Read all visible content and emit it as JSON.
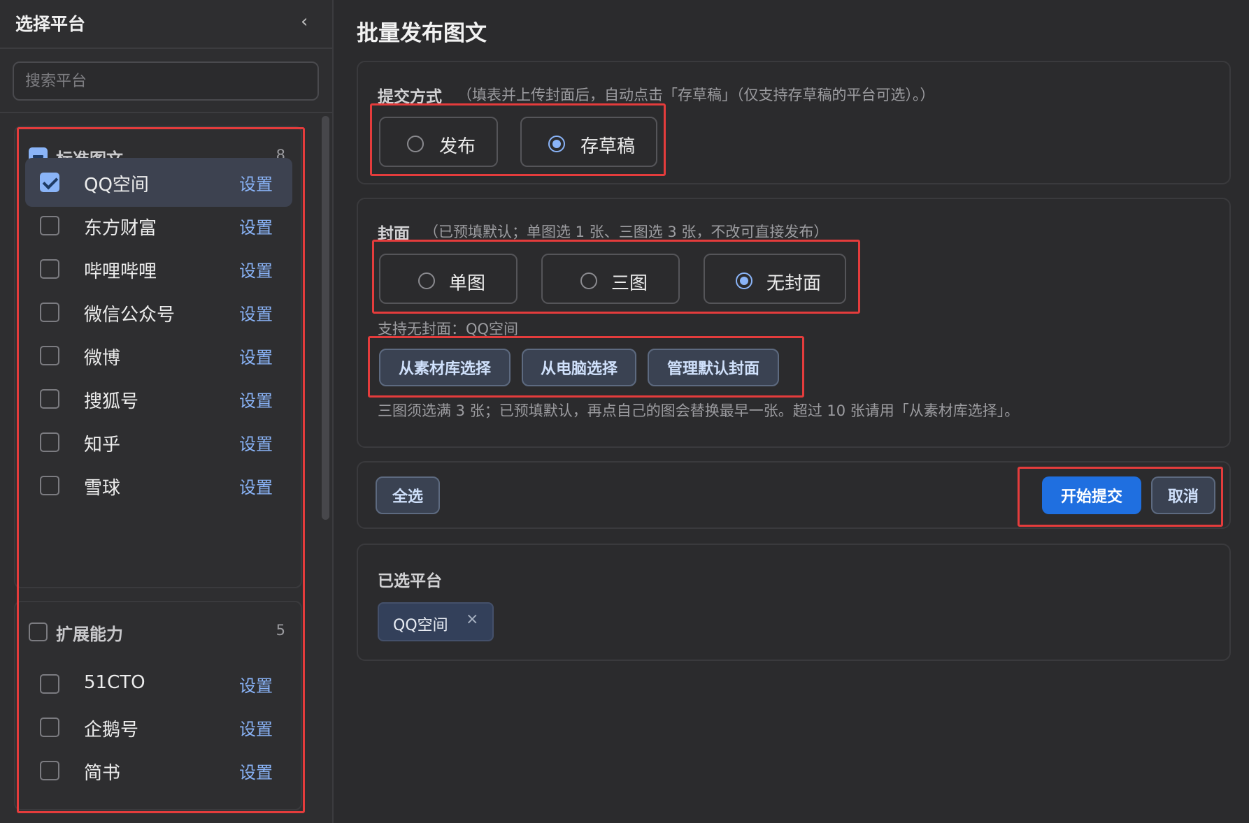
{
  "sidebar": {
    "title": "选择平台",
    "collapse_glyph": "‹",
    "search_placeholder": "搜索平台",
    "groups": [
      {
        "title": "标准图文",
        "count": "8",
        "state": "indeterminate",
        "items": [
          {
            "label": "QQ空间",
            "action": "设置",
            "checked": true
          },
          {
            "label": "东方财富",
            "action": "设置",
            "checked": false
          },
          {
            "label": "哔哩哔哩",
            "action": "设置",
            "checked": false
          },
          {
            "label": "微信公众号",
            "action": "设置",
            "checked": false
          },
          {
            "label": "微博",
            "action": "设置",
            "checked": false
          },
          {
            "label": "搜狐号",
            "action": "设置",
            "checked": false
          },
          {
            "label": "知乎",
            "action": "设置",
            "checked": false
          },
          {
            "label": "雪球",
            "action": "设置",
            "checked": false
          }
        ]
      },
      {
        "title": "扩展能力",
        "count": "5",
        "state": "unchecked",
        "items": [
          {
            "label": "51CTO",
            "action": "设置",
            "checked": false
          },
          {
            "label": "企鹅号",
            "action": "设置",
            "checked": false
          },
          {
            "label": "简书",
            "action": "设置",
            "checked": false
          }
        ]
      }
    ]
  },
  "main": {
    "title": "批量发布图文",
    "submit": {
      "label": "提交方式",
      "hint": "（填表并上传封面后，自动点击「存草稿」（仅支持存草稿的平台可选）。）",
      "options": [
        {
          "label": "发布",
          "selected": false
        },
        {
          "label": "存草稿",
          "selected": true
        }
      ]
    },
    "cover": {
      "label": "封面",
      "hint": "（已预填默认；单图选 1 张、三图选 3 张，不改可直接发布）",
      "options": [
        {
          "label": "单图",
          "selected": false
        },
        {
          "label": "三图",
          "selected": false
        },
        {
          "label": "无封面",
          "selected": true
        }
      ],
      "support_note": "支持无封面：QQ空间",
      "buttons": [
        "从素材库选择",
        "从电脑选择",
        "管理默认封面"
      ],
      "note": "三图须选满 3 张；已预填默认，再点自己的图会替换最早一张。超过 10 张请用「从素材库选择」。"
    },
    "actions": {
      "select_all": "全选",
      "start": "开始提交",
      "cancel": "取消"
    },
    "selected_platforms": {
      "label": "已选平台",
      "chips": [
        {
          "label": "QQ空间",
          "remove_glyph": "×"
        }
      ]
    }
  },
  "colors": {
    "accent": "#8ab4f8",
    "primary": "#1f6fe0",
    "highlight": "#e43c3c",
    "background": "#2b2b2d"
  }
}
